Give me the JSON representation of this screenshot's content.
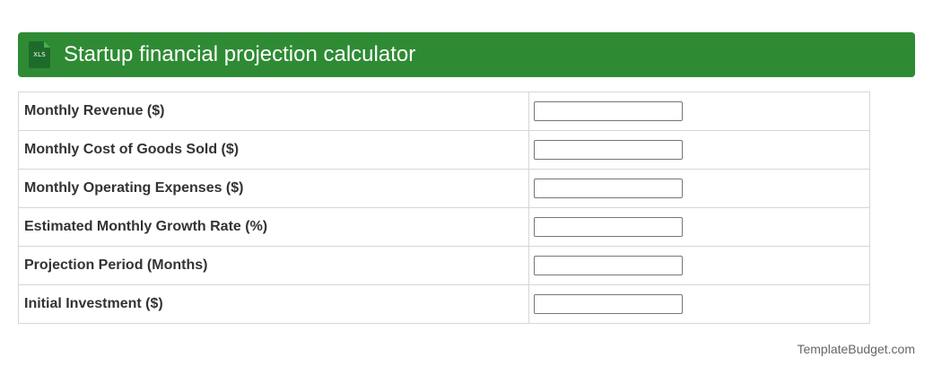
{
  "header": {
    "title": "Startup financial projection calculator",
    "icon": {
      "name": "xls-file-icon",
      "text": "XLS"
    },
    "background_color": "#2e8b34"
  },
  "form": {
    "fields": [
      {
        "label": "Monthly Revenue ($)",
        "value": ""
      },
      {
        "label": "Monthly Cost of Goods Sold ($)",
        "value": ""
      },
      {
        "label": "Monthly Operating Expenses ($)",
        "value": ""
      },
      {
        "label": "Estimated Monthly Growth Rate (%)",
        "value": ""
      },
      {
        "label": "Projection Period (Months)",
        "value": ""
      },
      {
        "label": "Initial Investment ($)",
        "value": ""
      }
    ]
  },
  "footer": {
    "credit": "TemplateBudget.com"
  }
}
